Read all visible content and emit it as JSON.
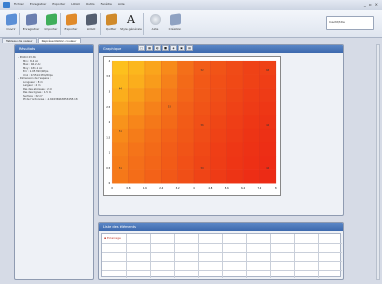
{
  "menu": [
    "Fichier",
    "Enregistrer",
    "Exporter",
    "LOGO",
    "Outils",
    "Fenêtre",
    "Aide"
  ],
  "window_controls": [
    "_",
    "▫",
    "×"
  ],
  "ribbon": {
    "buttons": [
      {
        "label": "Ouvrir",
        "icon": "open-folder-icon"
      },
      {
        "label": "Enregistrer",
        "icon": "save-icon"
      },
      {
        "label": "Importer",
        "icon": "import-icon"
      },
      {
        "label": "Exporter",
        "icon": "export-icon"
      },
      {
        "label": "LOGO",
        "icon": "device-icon"
      },
      {
        "label": "Quitter",
        "icon": "exit-icon"
      },
      {
        "label": "Style générale",
        "icon": "font-icon"
      },
      {
        "label": "Aide",
        "icon": "help-icon"
      },
      {
        "label": "Création",
        "icon": "create-icon"
      }
    ],
    "status_text": "Inactif/Idle"
  },
  "tabs": [
    "Tableau de valeur",
    "Représentation couleur"
  ],
  "results": {
    "title": "Résultats",
    "tree": [
      "- Pilotid 23 db",
      "Min : 8.4 Ac",
      "Max : 46.2 Ac",
      "Moy : 431.1 Ac",
      "Ecr : 1.05 Mm/Wrps",
      "Un1 : 0.5514 Mm/Wrps",
      "- Dimension de l'espace :",
      "Longueur : 8 m",
      "Largeur : 4 m",
      "Pas des abcisses : 2 m",
      "Pas des lignes : 1.5 m",
      "Surface : 32 m²",
      "Pt de l'ordonnée : -1.6023696385345E-18"
    ]
  },
  "graph": {
    "title": "Graphique",
    "toolbar": [
      "□",
      "▦",
      "◐",
      "■",
      "◈",
      "▣",
      "▤"
    ]
  },
  "heatmap": {
    "x_ticks": [
      "0",
      "0.8",
      "1.6",
      "2.4",
      "3.2",
      "4",
      "4.8",
      "5.6",
      "6.4",
      "7.2",
      "8"
    ],
    "y_ticks": [
      "0",
      "0.5",
      "1",
      "1.5",
      "2",
      "2.5",
      "3",
      "3.5",
      "4"
    ],
    "values": [
      [
        0.9,
        0.85,
        0.75,
        0.6,
        0.45,
        0.35,
        0.3,
        0.25,
        0.2,
        0.2
      ],
      [
        0.85,
        0.8,
        0.7,
        0.55,
        0.42,
        0.33,
        0.28,
        0.24,
        0.2,
        0.18
      ],
      [
        0.8,
        0.72,
        0.62,
        0.5,
        0.4,
        0.32,
        0.27,
        0.22,
        0.18,
        0.16
      ],
      [
        0.72,
        0.65,
        0.55,
        0.45,
        0.36,
        0.3,
        0.25,
        0.2,
        0.16,
        0.14
      ],
      [
        0.65,
        0.58,
        0.5,
        0.42,
        0.34,
        0.28,
        0.22,
        0.18,
        0.14,
        0.12
      ],
      [
        0.6,
        0.52,
        0.45,
        0.38,
        0.32,
        0.26,
        0.2,
        0.16,
        0.12,
        0.1
      ],
      [
        0.55,
        0.48,
        0.42,
        0.35,
        0.3,
        0.24,
        0.18,
        0.14,
        0.11,
        0.09
      ],
      [
        0.52,
        0.45,
        0.4,
        0.34,
        0.28,
        0.22,
        0.17,
        0.13,
        0.1,
        0.08
      ],
      [
        0.5,
        0.44,
        0.38,
        0.32,
        0.27,
        0.21,
        0.16,
        0.12,
        0.09,
        0.07
      ]
    ],
    "markers": [
      "52",
      "68",
      "44",
      "51",
      "56",
      "44",
      "51",
      "59",
      "44",
      "53"
    ]
  },
  "list": {
    "title": "Liste des éléments",
    "items": [
      "Eclairage"
    ]
  },
  "colors": {
    "accent": "#3d69ad",
    "ribbon": "#dfe5ef"
  }
}
